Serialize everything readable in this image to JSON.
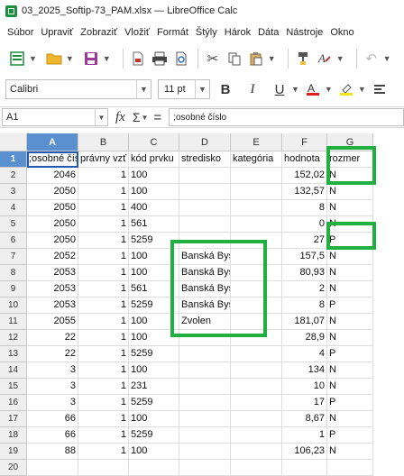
{
  "window": {
    "title": "03_2025_Softip-73_PAM.xlsx — LibreOffice Calc"
  },
  "menu": [
    "Súbor",
    "Upraviť",
    "Zobraziť",
    "Vložiť",
    "Formát",
    "Štýly",
    "Hárok",
    "Dáta",
    "Nástroje",
    "Okno"
  ],
  "toolbar": {
    "icons": [
      "new-spreadsheet-icon",
      "open-folder-icon",
      "save-icon",
      "export-pdf-icon",
      "print-icon",
      "print-preview-icon",
      "cut-icon",
      "copy-icon",
      "paste-icon",
      "clone-formatting-icon",
      "clear-formatting-icon",
      "undo-icon"
    ]
  },
  "format": {
    "font_name": "Calibri",
    "font_size": "11 pt",
    "bold": "B",
    "italic": "I",
    "underline": "U"
  },
  "formula": {
    "cell_ref": "A1",
    "fx": "fx",
    "sigma": "Σ",
    "equals": "=",
    "content": ";osobné číslo"
  },
  "columns": [
    "A",
    "B",
    "C",
    "D",
    "E",
    "F",
    "G"
  ],
  "rows": [
    {
      "n": "1",
      "a": ";osobné čís",
      "b": "právny vzť",
      "c": "kód prvku",
      "d": "stredisko",
      "e": "kategória",
      "f": "hodnota",
      "g": "rozmer"
    },
    {
      "n": "2",
      "a": "2046",
      "b": "1",
      "c": "100",
      "d": "",
      "e": "",
      "f": "152,02",
      "g": "N"
    },
    {
      "n": "3",
      "a": "2050",
      "b": "1",
      "c": "100",
      "d": "",
      "e": "",
      "f": "132,57",
      "g": "N"
    },
    {
      "n": "4",
      "a": "2050",
      "b": "1",
      "c": "400",
      "d": "",
      "e": "",
      "f": "8",
      "g": "N"
    },
    {
      "n": "5",
      "a": "2050",
      "b": "1",
      "c": "561",
      "d": "",
      "e": "",
      "f": "0",
      "g": "N"
    },
    {
      "n": "6",
      "a": "2050",
      "b": "1",
      "c": "5259",
      "d": "",
      "e": "",
      "f": "27",
      "g": "P"
    },
    {
      "n": "7",
      "a": "2052",
      "b": "1",
      "c": "100",
      "d": "Banská Bystrica",
      "e": "",
      "f": "157,5",
      "g": "N"
    },
    {
      "n": "8",
      "a": "2053",
      "b": "1",
      "c": "100",
      "d": "Banská Bystrica",
      "e": "",
      "f": "80,93",
      "g": "N"
    },
    {
      "n": "9",
      "a": "2053",
      "b": "1",
      "c": "561",
      "d": "Banská Bystrica",
      "e": "",
      "f": "2",
      "g": "N"
    },
    {
      "n": "10",
      "a": "2053",
      "b": "1",
      "c": "5259",
      "d": "Banská Bystrica",
      "e": "",
      "f": "8",
      "g": "P"
    },
    {
      "n": "11",
      "a": "2055",
      "b": "1",
      "c": "100",
      "d": "Zvolen",
      "e": "",
      "f": "181,07",
      "g": "N"
    },
    {
      "n": "12",
      "a": "22",
      "b": "1",
      "c": "100",
      "d": "",
      "e": "",
      "f": "28,9",
      "g": "N"
    },
    {
      "n": "13",
      "a": "22",
      "b": "1",
      "c": "5259",
      "d": "",
      "e": "",
      "f": "4",
      "g": "P"
    },
    {
      "n": "14",
      "a": "3",
      "b": "1",
      "c": "100",
      "d": "",
      "e": "",
      "f": "134",
      "g": "N"
    },
    {
      "n": "15",
      "a": "3",
      "b": "1",
      "c": "231",
      "d": "",
      "e": "",
      "f": "10",
      "g": "N"
    },
    {
      "n": "16",
      "a": "3",
      "b": "1",
      "c": "5259",
      "d": "",
      "e": "",
      "f": "17",
      "g": "P"
    },
    {
      "n": "17",
      "a": "66",
      "b": "1",
      "c": "100",
      "d": "",
      "e": "",
      "f": "8,67",
      "g": "N"
    },
    {
      "n": "18",
      "a": "66",
      "b": "1",
      "c": "5259",
      "d": "",
      "e": "",
      "f": "1",
      "g": "P"
    },
    {
      "n": "19",
      "a": "88",
      "b": "1",
      "c": "100",
      "d": "",
      "e": "",
      "f": "106,23",
      "g": "N"
    },
    {
      "n": "20",
      "a": "",
      "b": "",
      "c": "",
      "d": "",
      "e": "",
      "f": "",
      "g": ""
    }
  ],
  "colors": {
    "highlight": "#20b040",
    "selection": "#5a8fd0"
  }
}
